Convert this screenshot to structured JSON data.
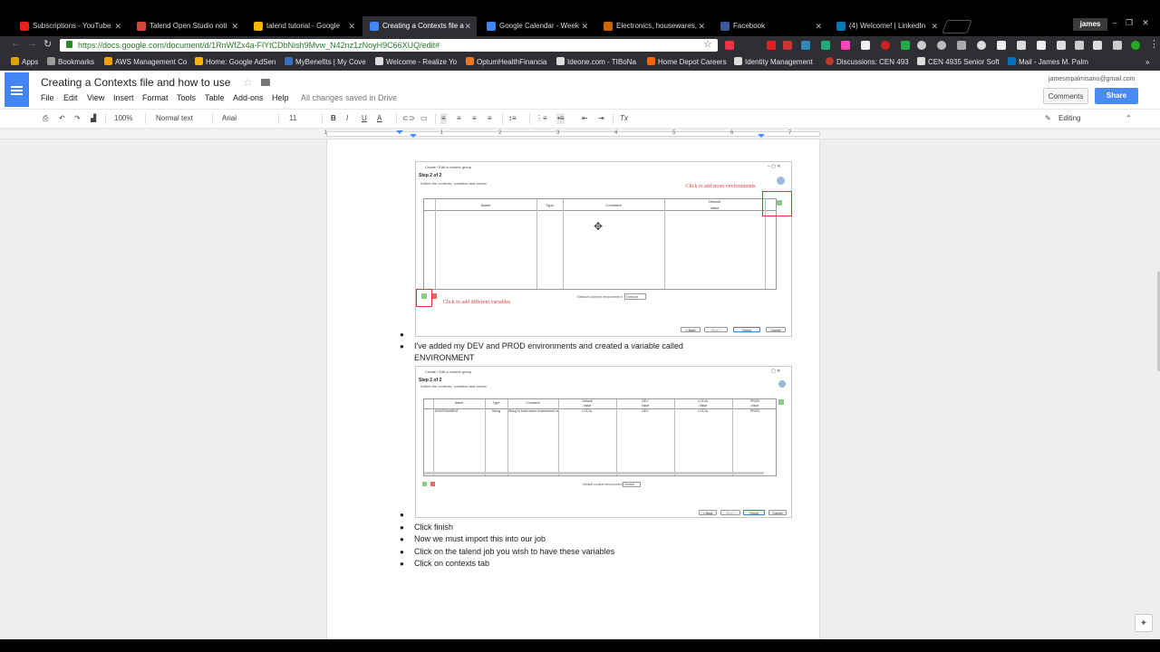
{
  "browser": {
    "tabs": [
      {
        "label": "Subscriptions - YouTube",
        "color": "#e62117"
      },
      {
        "label": "Talend Open Studio noti",
        "color": "#d44638"
      },
      {
        "label": "talend tutorial - Google",
        "color": "#f4b400"
      },
      {
        "label": "Creating a Contexts file a",
        "color": "#4285f4",
        "active": true
      },
      {
        "label": "Google Calendar - Week",
        "color": "#4285f4"
      },
      {
        "label": "Electronics, housewares,",
        "color": "#cc6600"
      },
      {
        "label": "Facebook",
        "color": "#3b5998"
      },
      {
        "label": "(4) Welcome! | LinkedIn",
        "color": "#0077b5"
      }
    ],
    "profile_name": "james",
    "url": "https://docs.google.com/document/d/1RnWfZx4a-FlYtCDbNish9Mvw_N42nz1zNoyH9C66XUQ/edit#",
    "bookmarks": [
      {
        "label": "Apps",
        "color": "#e0a000"
      },
      {
        "label": "Bookmarks",
        "color": "#777777"
      },
      {
        "label": "AWS Management Co",
        "color": "#f0a000"
      },
      {
        "label": "Home: Google AdSen",
        "color": "#f4b400"
      },
      {
        "label": "MyBenefits | My Cove",
        "color": "#3a6fc0"
      },
      {
        "label": "Welcome - Realize Yo",
        "color": "#dddddd"
      },
      {
        "label": "OptumHealthFinancia",
        "color": "#e87722"
      },
      {
        "label": "Ideone.com - TIBoNa",
        "color": "#dddddd"
      },
      {
        "label": "Home Depot Careers",
        "color": "#f96302"
      },
      {
        "label": "Identity Management",
        "color": "#dddddd"
      },
      {
        "label": "Discussions: CEN 493",
        "color": "#c0392b"
      },
      {
        "label": "CEN 4935 Senior Soft",
        "color": "#dddddd"
      },
      {
        "label": "Mail - James M. Palm",
        "color": "#0072c6"
      }
    ]
  },
  "docs": {
    "title": "Creating a Contexts file and how to use",
    "menu": [
      "File",
      "Edit",
      "View",
      "Insert",
      "Format",
      "Tools",
      "Table",
      "Add-ons",
      "Help"
    ],
    "saved_status": "All changes saved in Drive",
    "account_email": "jamesmpalmisano@gmail.com",
    "comments_label": "Comments",
    "share_label": "Share",
    "zoom": "100%",
    "style": "Normal text",
    "font": "Arial",
    "font_size": "11",
    "mode": "Editing",
    "ruler_numbers": [
      "1",
      "1",
      "2",
      "3",
      "4",
      "5",
      "6",
      "7"
    ],
    "accent": "#4285f4"
  },
  "screenshot1": {
    "window_title": "Create / Edit a context group",
    "step": "Step 2 of 2",
    "subtitle": "Define the contexts, variables and values",
    "headers": {
      "name": "Name",
      "type": "Type",
      "comment": "Comment",
      "default": "Default",
      "value": "Value"
    },
    "note_env": "Click to add more environments",
    "note_var": "Click to add different variables",
    "default_env_label": "Default context environment",
    "default_env_value": "Default",
    "buttons": [
      "< Back",
      "Next >",
      "Finish",
      "Cancel"
    ]
  },
  "screenshot2": {
    "window_title": "Create / Edit a context group",
    "step": "Step 2 of 2",
    "subtitle": "Define the contexts, variables and values",
    "headers": [
      "Name",
      "Type",
      "Comment",
      "Default",
      "DEV",
      "LOCAL",
      "PROD"
    ],
    "value_label": "Value",
    "row": {
      "name": "ENVIRONMENT",
      "type": "String",
      "comment": "String to build when environment us",
      "default": "LOCAL",
      "dev": "DEV",
      "local": "LOCAL",
      "prod": "PROD"
    },
    "default_env_label": "Default context environment",
    "default_env_value": "Default",
    "buttons": [
      "< Back",
      "Next >",
      "Finish",
      "Cancel"
    ]
  },
  "bullets": {
    "b1": "I've added my DEV and PROD environments and created a variable called ENVIRONMENT",
    "b3": "Click finish",
    "b4": "Now we must import this into our job",
    "b5": "Click on the talend job you wish to have these variables",
    "b6": "Click on contexts tab"
  }
}
